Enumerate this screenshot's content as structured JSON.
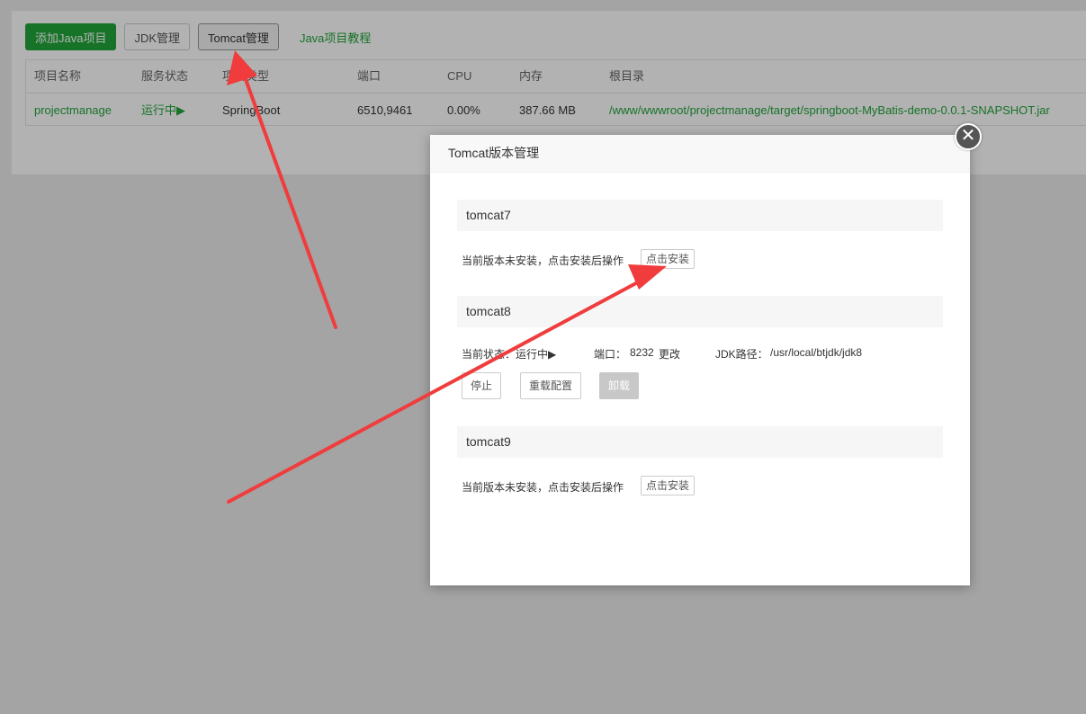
{
  "toolbar": {
    "add_java_project": "添加Java项目",
    "jdk_manage": "JDK管理",
    "tomcat_manage": "Tomcat管理",
    "java_tutorial": "Java项目教程"
  },
  "table": {
    "columns": [
      "项目名称",
      "服务状态",
      "项目类型",
      "端口",
      "CPU",
      "内存",
      "根目录"
    ],
    "rows": [
      {
        "name": "projectmanage",
        "status": "运行中▶",
        "type": "SpringBoot",
        "port": "6510,9461",
        "cpu": "0.00%",
        "memory": "387.66 MB",
        "root": "/www/wwwroot/projectmanage/target/springboot-MyBatis-demo-0.0.1-SNAPSHOT.jar"
      }
    ]
  },
  "dialog": {
    "title": "Tomcat版本管理",
    "close_glyph": "✕",
    "tomcat7": {
      "name": "tomcat7",
      "status_text": "当前版本未安装，点击安装后操作",
      "install_label": "点击安装"
    },
    "tomcat8": {
      "name": "tomcat8",
      "status_label": "当前状态：",
      "status_value": "运行中▶",
      "port_label": "端口：",
      "port_value": "8232",
      "port_change": "更改",
      "jdk_label": "JDK路径：",
      "jdk_value": "/usr/local/btjdk/jdk8",
      "stop_label": "停止",
      "reload_label": "重载配置",
      "uninstall_label": "卸载"
    },
    "tomcat9": {
      "name": "tomcat9",
      "status_text": "当前版本未安装，点击安装后操作",
      "install_label": "点击安装"
    }
  },
  "colors": {
    "brand_green": "#20a53a",
    "arrow_red": "#f03c3c"
  },
  "icons": [
    "close-icon",
    "red-annotation-arrow"
  ]
}
